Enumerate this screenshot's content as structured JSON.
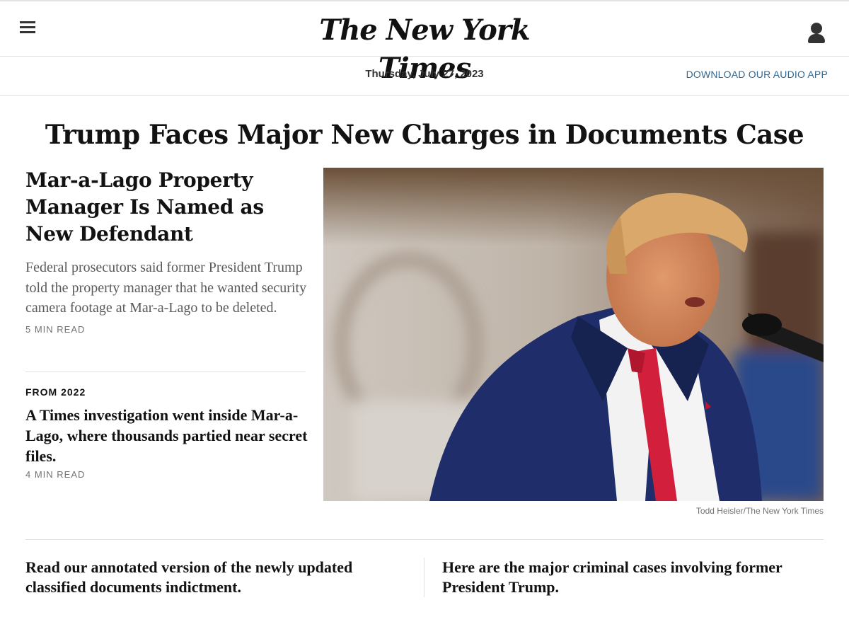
{
  "header": {
    "menu_icon": "hamburger-menu-icon",
    "masthead": "The New York Times",
    "user_icon": "user-account-icon"
  },
  "datebar": {
    "date": "Thursday, July 27, 2023",
    "audio_link": "DOWNLOAD OUR AUDIO APP"
  },
  "main": {
    "headline": "Trump Faces Major New Charges in Documents Case",
    "lead_story": {
      "headline": "Mar-a-Lago Property Manager Is Named as New Defendant",
      "summary": "Federal prosecutors said former President Trump told the property manager that he wanted security camera footage at Mar-a-Lago to be deleted.",
      "read_time": "5 MIN READ"
    },
    "secondary_story": {
      "kicker": "FROM 2022",
      "headline": "A Times investigation went inside Mar-a-Lago, where thousands partied near secret files.",
      "read_time": "4 MIN READ"
    },
    "photo_credit": "Todd Heisler/The New York Times"
  },
  "bottom_links": [
    {
      "text": "Read our annotated version of the newly updated classified documents indictment."
    },
    {
      "text": "Here are the major criminal cases involving former President Trump."
    }
  ],
  "colors": {
    "link_blue": "#326891",
    "text_dark": "#121212",
    "text_gray": "#5a5a5a",
    "divider": "#dfdfdf"
  }
}
